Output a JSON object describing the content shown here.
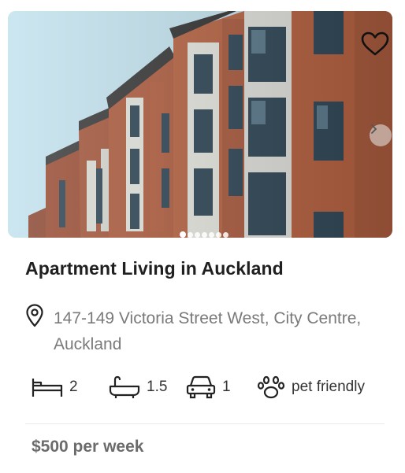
{
  "listing": {
    "title": "Apartment Living in Auckland",
    "address": "147-149 Victoria Street West, City Centre, Auckland",
    "price": "$500 per week"
  },
  "carousel": {
    "slide_count": 7,
    "active_index": 0
  },
  "features": {
    "bedrooms": "2",
    "bathrooms": "1.5",
    "parking": "1",
    "pets": "pet friendly"
  },
  "icons": [
    "heart-icon",
    "chevron-right-icon",
    "map-pin-icon",
    "bed-icon",
    "bathtub-icon",
    "car-icon",
    "paw-icon"
  ],
  "colors": {
    "sky": "#bfe0ec",
    "brick": "#a8553a",
    "text_primary": "#202020",
    "text_secondary": "#7a7a7a"
  }
}
